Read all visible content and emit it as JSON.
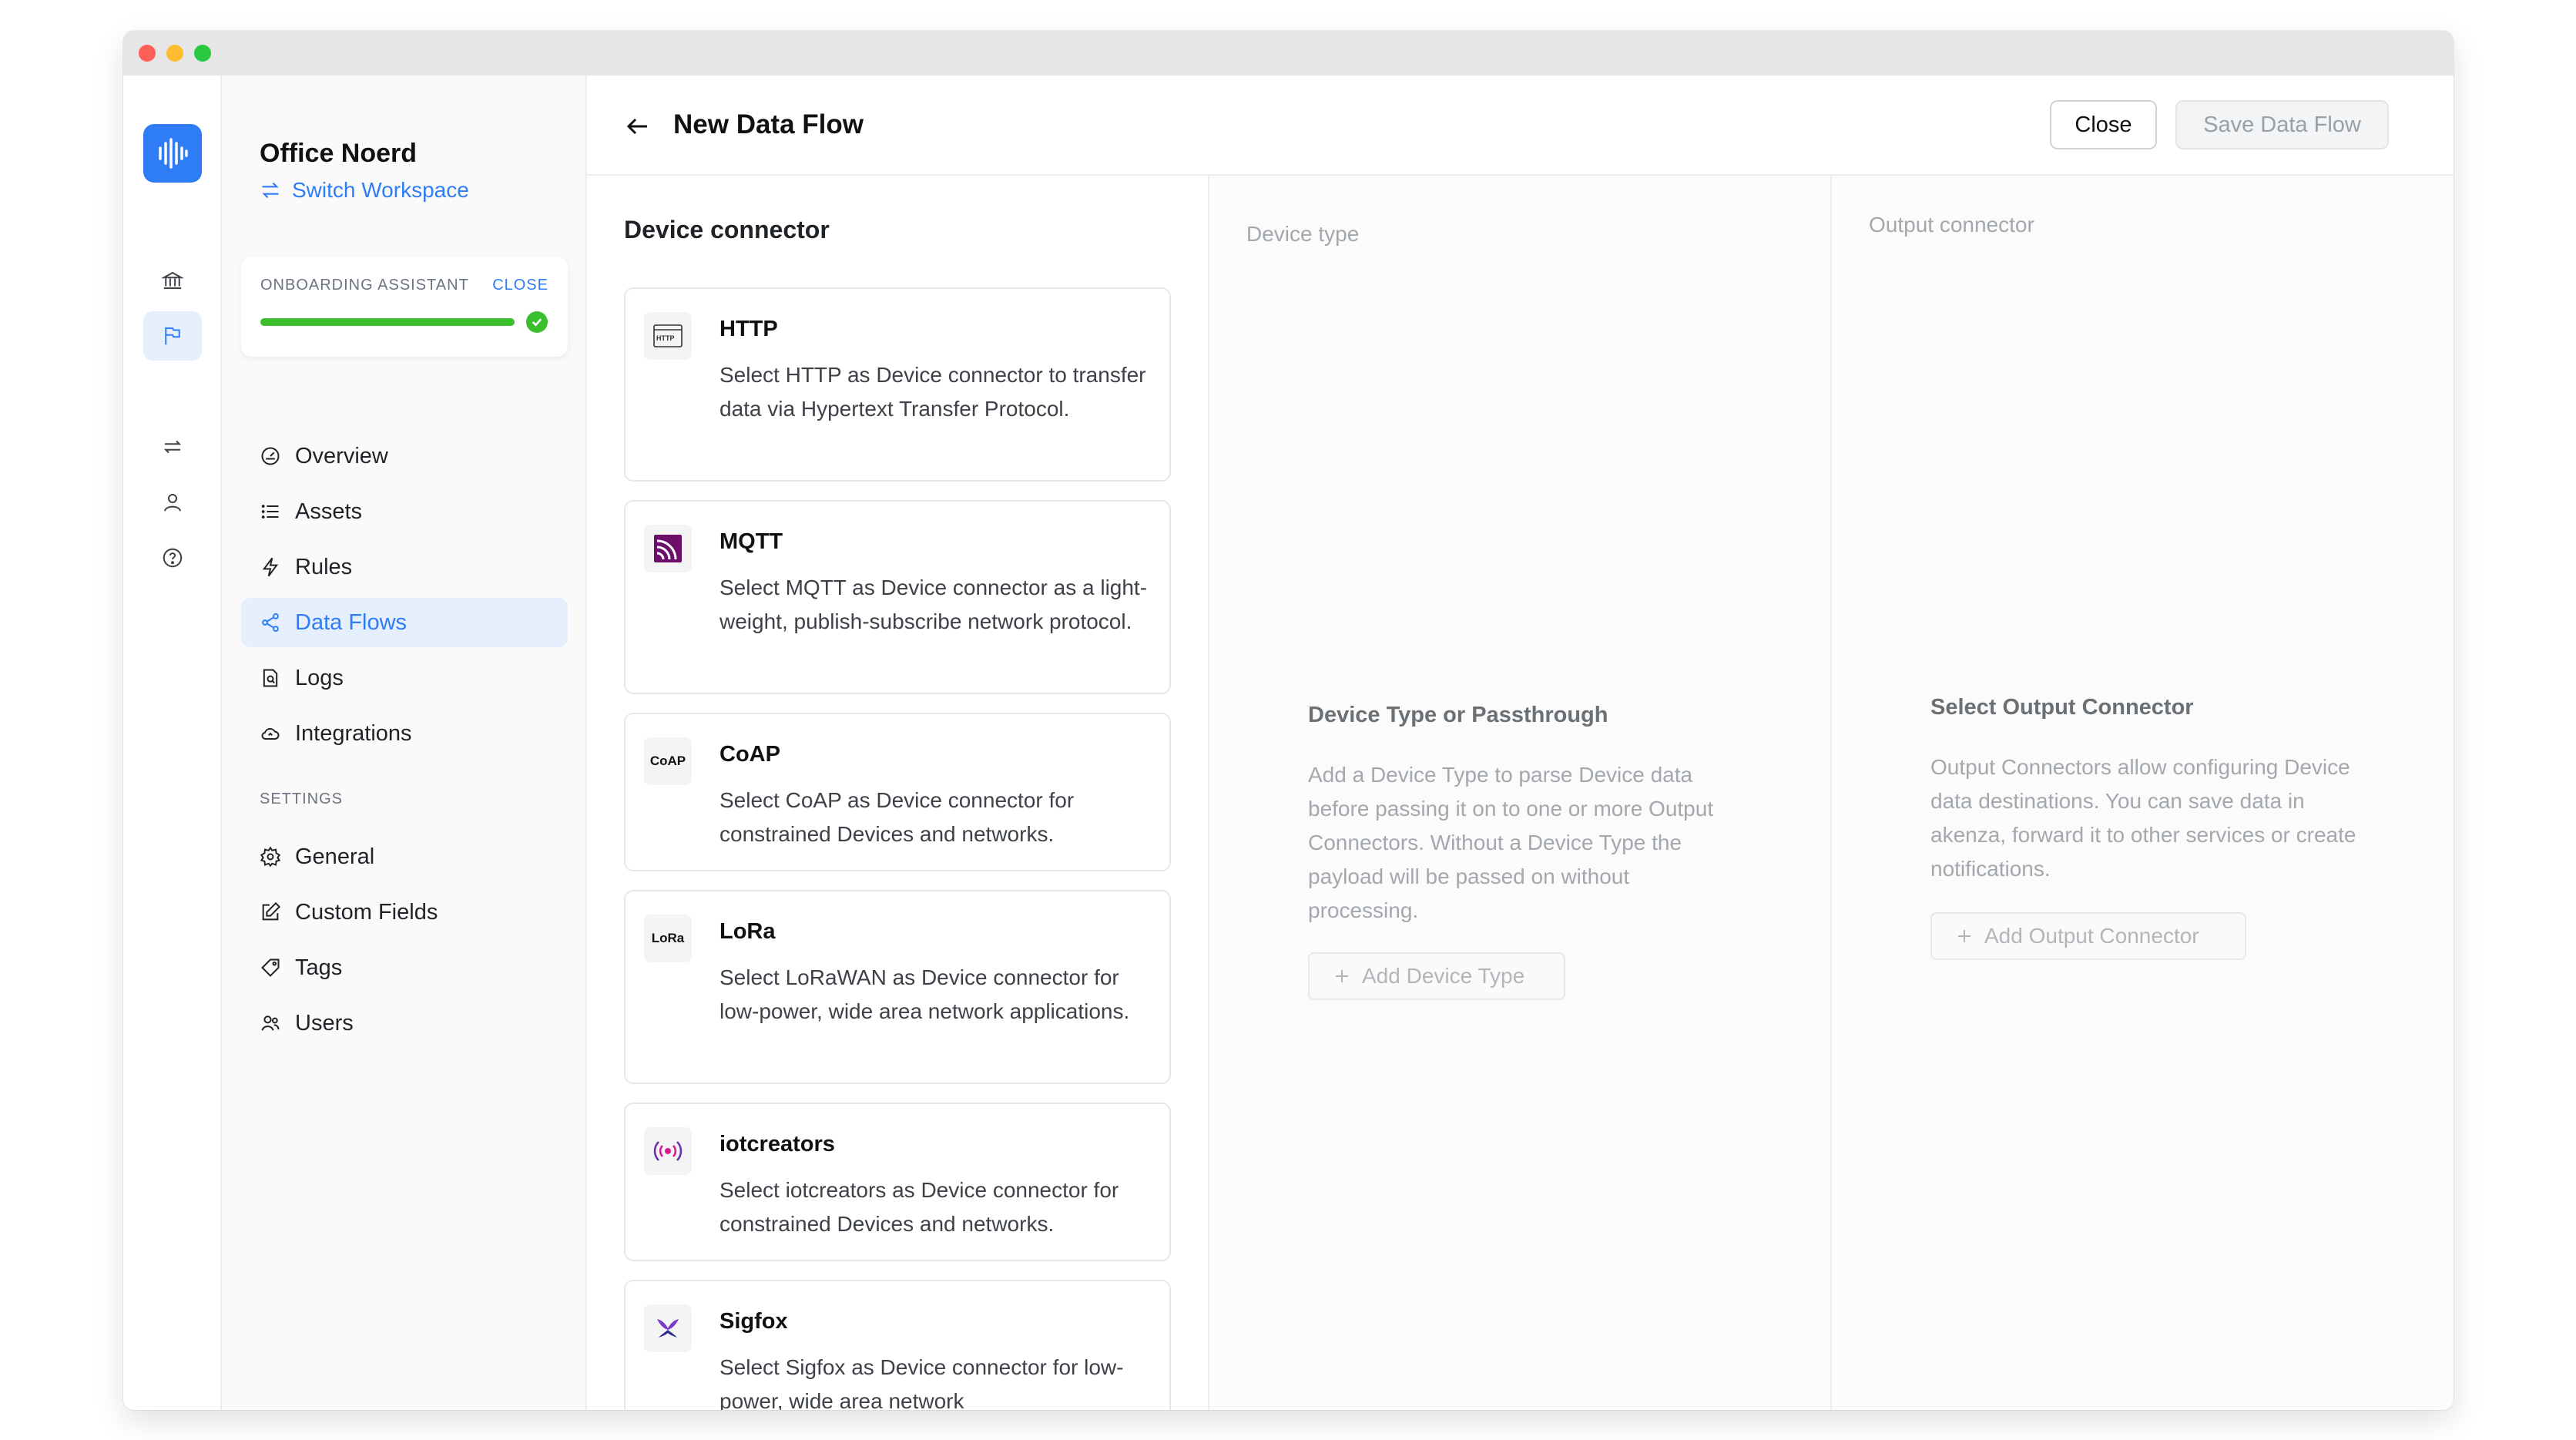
{
  "workspace": {
    "name": "Office Noerd",
    "switch_label": "Switch Workspace"
  },
  "onboarding": {
    "label": "ONBOARDING ASSISTANT",
    "close_label": "CLOSE",
    "progress": 1.0
  },
  "nav": [
    {
      "label": "Overview",
      "icon": "dashboard-gauge-icon"
    },
    {
      "label": "Assets",
      "icon": "list-icon"
    },
    {
      "label": "Rules",
      "icon": "lightning-icon"
    },
    {
      "label": "Data Flows",
      "icon": "share-nodes-icon",
      "active": true
    },
    {
      "label": "Logs",
      "icon": "document-search-icon"
    },
    {
      "label": "Integrations",
      "icon": "cloud-icon"
    }
  ],
  "settings": {
    "label": "SETTINGS",
    "items": [
      {
        "label": "General",
        "icon": "gear-icon"
      },
      {
        "label": "Custom Fields",
        "icon": "edit-icon"
      },
      {
        "label": "Tags",
        "icon": "tag-icon"
      },
      {
        "label": "Users",
        "icon": "users-icon"
      }
    ]
  },
  "header": {
    "title": "New Data Flow",
    "close_label": "Close",
    "save_label": "Save Data Flow"
  },
  "device_connector": {
    "title": "Device connector",
    "items": [
      {
        "name": "HTTP",
        "icon_text": "HTTP",
        "desc": "Select HTTP as Device connector to transfer data via Hypertext Transfer Protocol."
      },
      {
        "name": "MQTT",
        "icon_text": "",
        "desc": "Select MQTT as Device connector as a light-weight, publish-subscribe network protocol."
      },
      {
        "name": "CoAP",
        "icon_text": "CoAP",
        "desc": "Select CoAP as Device connector for constrained Devices and networks."
      },
      {
        "name": "LoRa",
        "icon_text": "LoRa",
        "desc": "Select LoRaWAN as Device connector for low-power, wide area network applications."
      },
      {
        "name": "iotcreators",
        "icon_text": "",
        "desc": "Select iotcreators as Device connector for constrained Devices and networks."
      },
      {
        "name": "Sigfox",
        "icon_text": "",
        "desc": "Select Sigfox as Device connector for low-power, wide area network"
      }
    ]
  },
  "device_type": {
    "header": "Device type",
    "empty_title": "Device Type or Passthrough",
    "empty_desc": "Add a Device Type to parse Device data before passing it on to one or more Output Connectors. Without a Device Type the payload will be passed on without processing.",
    "button": "Add Device Type"
  },
  "output_connector": {
    "header": "Output connector",
    "empty_title": "Select Output Connector",
    "empty_desc": "Output Connectors allow configuring Device data destinations. You can save data in akenza, forward it to other services or create notifications.",
    "button": "Add Output Connector"
  },
  "colors": {
    "accent": "#2f7df6",
    "success": "#3bbf2c",
    "mqtt": "#6b0f6b",
    "iotcreators": "#d81b8f",
    "sigfox": "#7a3cc4"
  }
}
